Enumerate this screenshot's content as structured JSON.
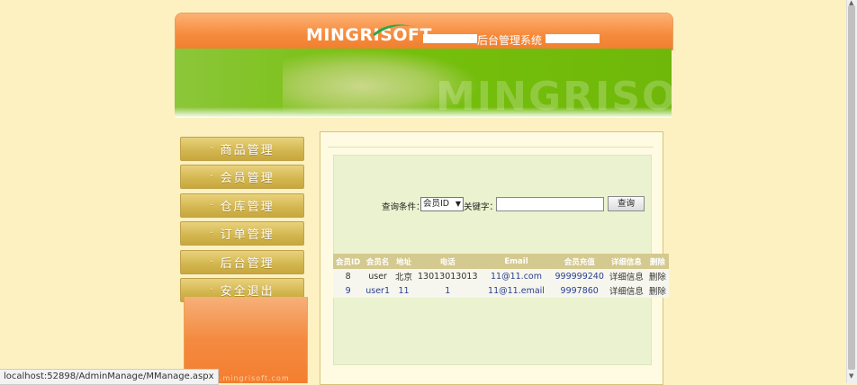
{
  "header": {
    "logo_text": "INGRISOFT",
    "logo_initial": "M",
    "system_title": "后台管理系统",
    "banner_watermark": "INGRISOFT"
  },
  "sidebar": {
    "items": [
      {
        "label": "商品管理"
      },
      {
        "label": "会员管理"
      },
      {
        "label": "仓库管理"
      },
      {
        "label": "订单管理"
      },
      {
        "label": "后台管理"
      },
      {
        "label": "安全退出"
      }
    ],
    "bullet": "·",
    "footer_text": "www.mingrisoft.com"
  },
  "search": {
    "condition_label": "查询条件：",
    "selected_option": "会员ID",
    "keyword_label": "关键字：",
    "keyword_value": "",
    "query_button": "查询"
  },
  "table": {
    "headers": [
      "会员ID",
      "会员名",
      "地址",
      "电话",
      "Email",
      "会员充值",
      "详细信息",
      "删除"
    ],
    "rows": [
      [
        "8",
        "user",
        "北京",
        "13013013013",
        "11@11.com",
        "999999240",
        "详细信息",
        "删除"
      ],
      [
        "9",
        "user1",
        "11",
        "1",
        "11@11.email",
        "9997860",
        "详细信息",
        "删除"
      ]
    ]
  },
  "status_bar": {
    "url": "localhost:52898/AdminManage/MManage.aspx"
  },
  "colors": {
    "page_bg": "#fdf1c2",
    "header_orange": "#f58a3c",
    "banner_green": "#76c00c",
    "nav_gold": "#d2b54e",
    "panel_green": "#ebf2cf",
    "table_header": "#d4c98e"
  }
}
